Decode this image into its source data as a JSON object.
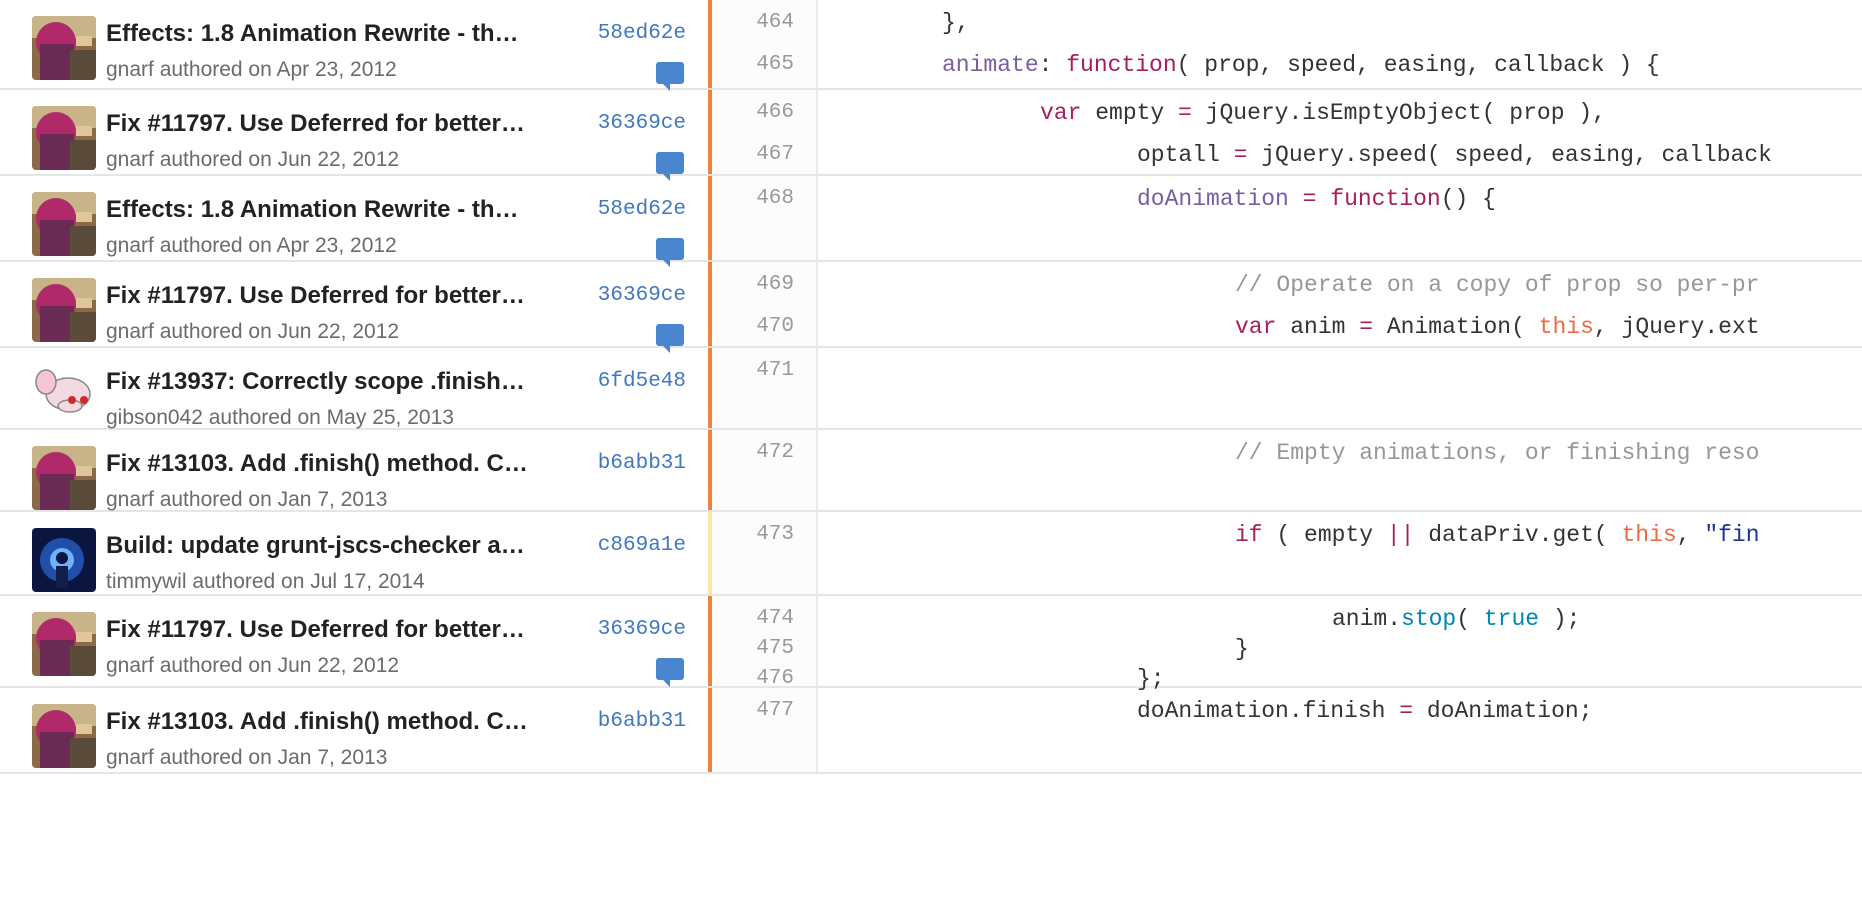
{
  "colors": {
    "sha": "#4078c0",
    "bar_recent": "#f0833a",
    "bar_newer": "#f9e9a9",
    "comment": "#4a85d0"
  },
  "groups": [
    {
      "message": "Effects: 1.8 Animation Rewrite - th…",
      "author": "gnarf authored on Apr 23, 2012",
      "sha": "58ed62e",
      "avatar": "gnarf-avatar"
    },
    {
      "message": "Fix #11797. Use Deferred for better…",
      "author": "gnarf authored on Jun 22, 2012",
      "sha": "36369ce",
      "avatar": "gnarf-avatar"
    },
    {
      "message": "Effects: 1.8 Animation Rewrite - th…",
      "author": "gnarf authored on Apr 23, 2012",
      "sha": "58ed62e",
      "avatar": "gnarf-avatar"
    },
    {
      "message": "Fix #11797. Use Deferred for better…",
      "author": "gnarf authored on Jun 22, 2012",
      "sha": "36369ce",
      "avatar": "gnarf-avatar"
    },
    {
      "message": "Fix #13937: Correctly scope .finish…",
      "author": "gibson042 authored on May 25, 2013",
      "sha": "6fd5e48",
      "avatar": "gibson042-avatar"
    },
    {
      "message": "Fix #13103. Add .finish() method. C…",
      "author": "gnarf authored on Jan 7, 2013",
      "sha": "b6abb31",
      "avatar": "gnarf-avatar"
    },
    {
      "message": "Build: update grunt-jscs-checker a…",
      "author": "timmywil authored on Jul 17, 2014",
      "sha": "c869a1e",
      "avatar": "timmywil-avatar"
    },
    {
      "message": "Fix #11797. Use Deferred for better…",
      "author": "gnarf authored on Jun 22, 2012",
      "sha": "36369ce",
      "avatar": "gnarf-avatar"
    },
    {
      "message": "Fix #13103. Add .finish() method. C…",
      "author": "gnarf authored on Jan 7, 2013",
      "sha": "b6abb31",
      "avatar": "gnarf-avatar"
    }
  ],
  "lines": [
    {
      "n": "464",
      "tokens": [
        [
          "p",
          "},"
        ]
      ]
    },
    {
      "n": "465",
      "tokens": [
        [
          "fn",
          "animate"
        ],
        [
          "p",
          ": "
        ],
        [
          "kw",
          "function"
        ],
        [
          "p",
          "( prop, speed, easing, callback ) {"
        ]
      ]
    },
    {
      "n": "466",
      "tokens": [
        [
          "kw",
          "var"
        ],
        [
          "p",
          " empty "
        ],
        [
          "kw",
          "="
        ],
        [
          "p",
          " jQuery.isEmptyObject( prop ),"
        ]
      ]
    },
    {
      "n": "467",
      "tokens": [
        [
          "p",
          "optall "
        ],
        [
          "kw",
          "="
        ],
        [
          "p",
          " jQuery.speed( speed, easing, callback"
        ]
      ]
    },
    {
      "n": "468",
      "tokens": [
        [
          "fn",
          "doAnimation"
        ],
        [
          "p",
          " "
        ],
        [
          "kw",
          "="
        ],
        [
          "p",
          " "
        ],
        [
          "kw",
          "function"
        ],
        [
          "p",
          "() {"
        ]
      ]
    },
    {
      "n": "469",
      "tokens": [
        [
          "cm",
          "// Operate on a copy of prop so per-pr"
        ]
      ]
    },
    {
      "n": "470",
      "tokens": [
        [
          "kw",
          "var"
        ],
        [
          "p",
          " anim "
        ],
        [
          "kw",
          "="
        ],
        [
          "p",
          " Animation( "
        ],
        [
          "sv",
          "this"
        ],
        [
          "p",
          ", jQuery.ext"
        ]
      ]
    },
    {
      "n": "471",
      "tokens": []
    },
    {
      "n": "472",
      "tokens": [
        [
          "cm",
          "// Empty animations, or finishing reso"
        ]
      ]
    },
    {
      "n": "473",
      "tokens": [
        [
          "kw",
          "if"
        ],
        [
          "p",
          " ( empty "
        ],
        [
          "kw",
          "||"
        ],
        [
          "p",
          " dataPriv.get( "
        ],
        [
          "sv",
          "this"
        ],
        [
          "p",
          ", "
        ],
        [
          "st",
          "\"fin"
        ]
      ]
    },
    {
      "n": "474",
      "tokens": [
        [
          "p",
          "anim."
        ],
        [
          "bl",
          "stop"
        ],
        [
          "p",
          "( "
        ],
        [
          "bl",
          "true"
        ],
        [
          "p",
          " );"
        ]
      ]
    },
    {
      "n": "475",
      "tokens": [
        [
          "p",
          "}"
        ]
      ]
    },
    {
      "n": "476",
      "tokens": [
        [
          "p",
          "};"
        ]
      ]
    },
    {
      "n": "477",
      "tokens": [
        [
          "p",
          "doAnimation.finish "
        ],
        [
          "kw",
          "="
        ],
        [
          "p",
          " doAnimation;"
        ]
      ]
    }
  ]
}
